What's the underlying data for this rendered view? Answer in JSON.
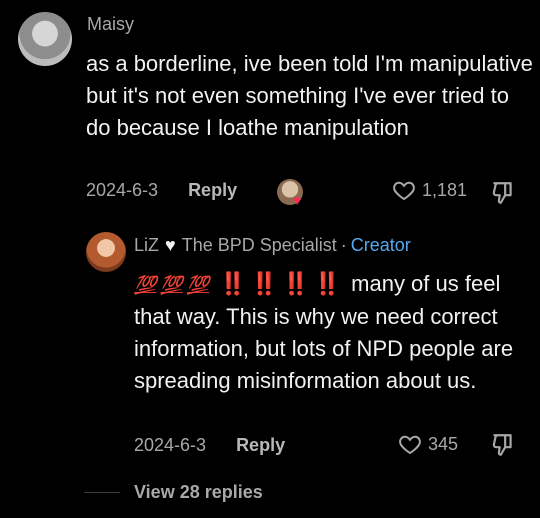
{
  "comment": {
    "username": "Maisy",
    "text": "as a borderline, ive been told I'm manipulative but it's not even something I've ever tried to do because I loathe manipulation",
    "date": "2024-6-3",
    "reply_label": "Reply",
    "like_count": "1,181"
  },
  "reply": {
    "username": "LiZ",
    "display_name": "The BPD Specialist",
    "separator": "·",
    "role": "Creator",
    "emojis_100": [
      "💯",
      "💯",
      "💯"
    ],
    "emojis_bang": [
      "‼️",
      "‼️",
      "‼️",
      "‼️"
    ],
    "text": "many of us feel that way. This is why we need correct information, but lots of NPD people are spreading misinformation about us.",
    "date": "2024-6-3",
    "reply_label": "Reply",
    "like_count": "345"
  },
  "view_replies": "View 28 replies",
  "colors": {
    "background": "#000000",
    "creator": "#57a9ef",
    "muted": "#a8a8ab"
  }
}
